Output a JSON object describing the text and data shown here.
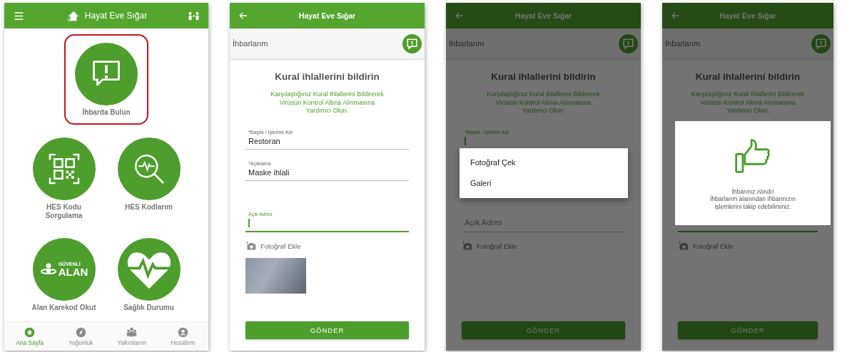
{
  "home_screen": {
    "header": {
      "title": "Hayat Eve Sığar"
    },
    "tiles": [
      {
        "kind": "report",
        "label": "İhbarda Bulun",
        "highlighted": true
      },
      {
        "kind": "qr",
        "label": "HES Kodu Sorgulama",
        "highlighted": false
      },
      {
        "kind": "search",
        "label": "HES Kodlarım",
        "highlighted": false
      },
      {
        "kind": "safe-area",
        "label": "Alan Karekod Okut",
        "highlighted": false,
        "icon_text_top": "GÜVENLİ",
        "icon_text_main": "ALAN"
      },
      {
        "kind": "health",
        "label": "Sağlık Durumu",
        "highlighted": false
      }
    ],
    "nav": [
      {
        "kind": "home",
        "label": "Ana Sayfa",
        "selected": true
      },
      {
        "kind": "compass",
        "label": "Yoğunluk",
        "selected": false
      },
      {
        "kind": "group",
        "label": "Yakınlarım",
        "selected": false
      },
      {
        "kind": "account",
        "label": "Hesabım",
        "selected": false
      }
    ]
  },
  "form_screens": [
    {
      "header": {
        "title": "Hayat Eve Sığar"
      },
      "section_title": "İhbarlarım",
      "heading": "Kural ihlallerini bildirin",
      "intro": "Karşılaştığınız Kural Ihlallerini Bildirerek Virüsün Kontrol Altına Alınmasına Yardımcı Olun.",
      "fields": [
        {
          "label": "*Başlık / İşletme Adı",
          "value": "Restoran",
          "focused": false
        },
        {
          "label": "*Açıklama",
          "value": "Maske ihlali",
          "focused": false
        },
        {
          "label": "Açık Adres",
          "focused": true
        }
      ],
      "photo_button": "Fotoğraf Ekle",
      "photo_attached": true,
      "submit": "GÖNDER"
    },
    {
      "header": {
        "title": "Hayat Eve Sığar"
      },
      "section_title": "İhbarlarım",
      "heading": "Kural ihlallerini bildirin",
      "intro": "Karşılaştığınız Kural Ihlallerini Bildirerek Virüsün Kontrol Altına Alınmasına Yardımcı Olun.",
      "fields": [
        {
          "label": "*Başlık / İşletme Adı",
          "focused": true
        },
        {
          "placeholder": "Açık Adres",
          "focused": false
        }
      ],
      "photo_button": "Fotoğraf Ekle",
      "photo_attached": false,
      "submit": "GÖNDER",
      "menu": {
        "items": [
          "Fotoğraf Çek",
          "Galeri"
        ]
      }
    },
    {
      "header": {
        "title": "Hayat Eve Sığar"
      },
      "section_title": "İhbarlarım",
      "heading": "Kural ihlallerini bildirin",
      "intro": "Karşılaştığınız Kural Ihlallerini Bildirerek Virüsün Kontrol Altına Alınmasına Yardımcı Olun.",
      "fields": [
        {
          "focused": true
        }
      ],
      "photo_button": "Fotoğraf Ekle",
      "photo_attached": false,
      "submit": "GÖNDER",
      "dialog": {
        "title": "İhbarınız Alındı!",
        "message": "İhbarlarım alanından ihbarınızın işlemlerini takip edebilirsiniz."
      }
    }
  ]
}
